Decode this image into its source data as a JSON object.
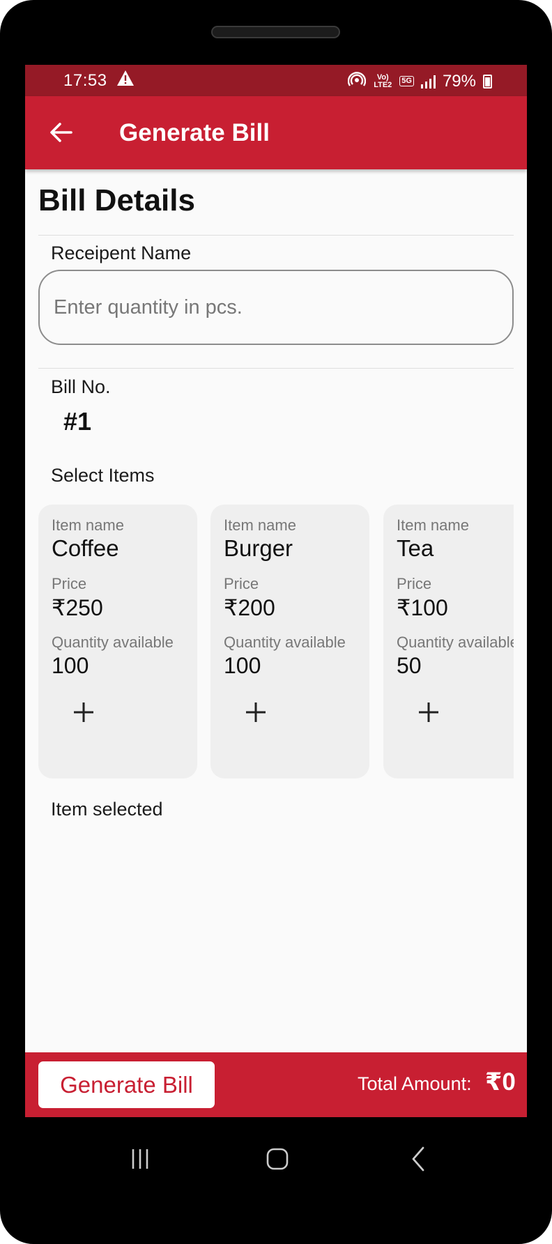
{
  "status_bar": {
    "time": "17:53",
    "battery": "79%",
    "icons": [
      "warning-icon",
      "hotspot-icon",
      "volte-icon",
      "5g-icon",
      "signal-icon",
      "battery-icon"
    ],
    "volte_text": "Vo) LTE2",
    "network_text": "5G"
  },
  "app_bar": {
    "title": "Generate Bill",
    "back_icon": "arrow-left-icon",
    "color": "#c81f32"
  },
  "bill_details": {
    "title": "Bill Details",
    "recipient_label": "Receipent Name",
    "recipient_placeholder": "Enter quantity in pcs.",
    "recipient_value": "",
    "bill_no_label": "Bill No.",
    "bill_no_value": "#1",
    "select_items_label": "Select Items",
    "item_selected_label": "Item selected"
  },
  "items": [
    {
      "name_label": "Item name",
      "name": "Coffee",
      "price_label": "Price",
      "price": "₹250",
      "qty_label": "Quantity available",
      "qty": "100",
      "add_icon": "plus-icon"
    },
    {
      "name_label": "Item name",
      "name": "Burger",
      "price_label": "Price",
      "price": "₹200",
      "qty_label": "Quantity available",
      "qty": "100",
      "add_icon": "plus-icon"
    },
    {
      "name_label": "Item name",
      "name": "Tea",
      "price_label": "Price",
      "price": "₹100",
      "qty_label": "Quantity available",
      "qty": "50",
      "add_icon": "plus-icon"
    }
  ],
  "bottom_bar": {
    "generate_button": "Generate Bill",
    "total_label": "Total Amount:",
    "total_value": "₹0"
  },
  "nav_bar": {
    "icons": [
      "recents-icon",
      "home-icon",
      "back-icon"
    ]
  }
}
